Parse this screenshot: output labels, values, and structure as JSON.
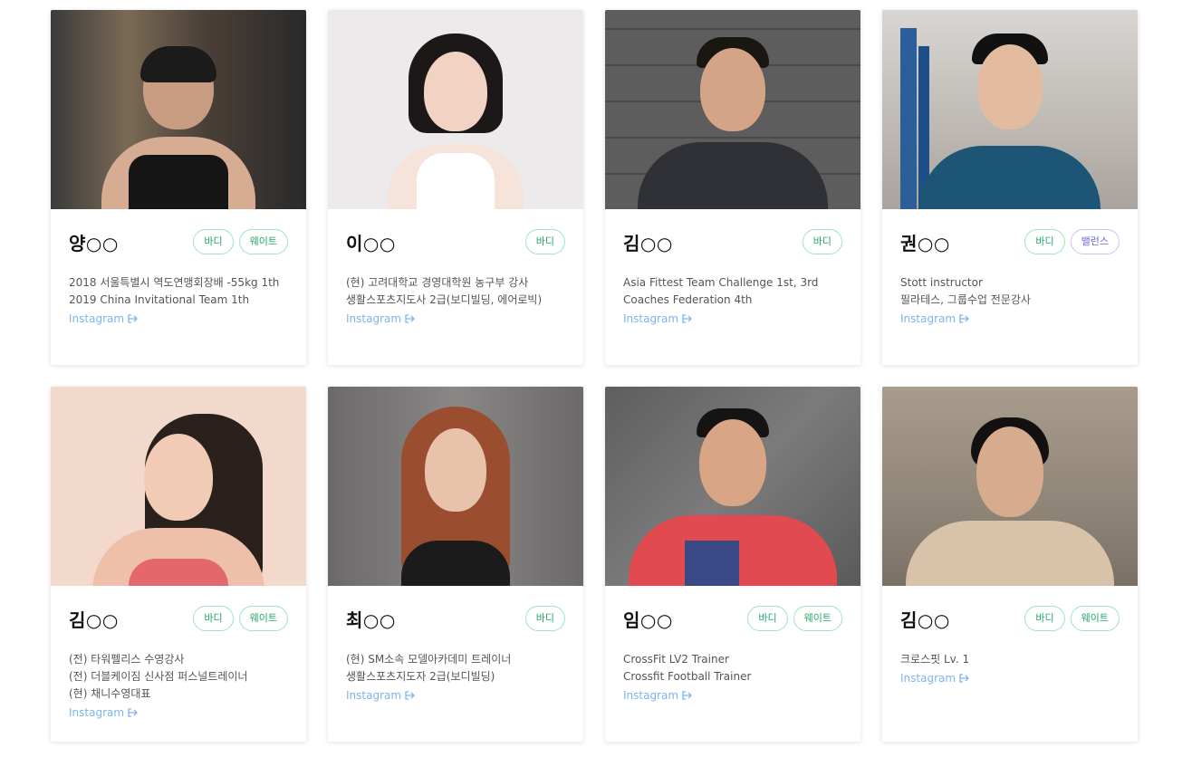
{
  "instagram_label": "Instagram",
  "trainers": [
    {
      "name": "양○○",
      "tags": [
        "바디",
        "웨이트"
      ],
      "desc": [
        "2018 서울특별시 역도연맹회장배 -55kg 1th",
        "2019 China Invitational Team 1th"
      ]
    },
    {
      "name": "이○○",
      "tags": [
        "바디"
      ],
      "desc": [
        "(현) 고려대학교 경영대학원 농구부 강사",
        "생활스포츠지도사 2급(보디빌딩, 에어로빅)"
      ]
    },
    {
      "name": "김○○",
      "tags": [
        "바디"
      ],
      "desc": [
        "Asia Fittest Team Challenge 1st, 3rd",
        "Coaches Federation 4th"
      ]
    },
    {
      "name": "권○○",
      "tags": [
        "바디",
        "밸런스"
      ],
      "desc": [
        "Stott instructor",
        "필라테스, 그룹수업 전문강사"
      ]
    },
    {
      "name": "김○○",
      "tags": [
        "바디",
        "웨이트"
      ],
      "desc": [
        "(전) 타워펠리스 수영강사",
        "(전) 더블케이짐 신사점 퍼스널트레이너",
        "(현) 채니수영대표"
      ]
    },
    {
      "name": "최○○",
      "tags": [
        "바디"
      ],
      "desc": [
        "(현) SM소속 모델아카데미 트레이너",
        "생활스포츠지도자 2급(보디빌딩)"
      ]
    },
    {
      "name": "임○○",
      "tags": [
        "바디",
        "웨이트"
      ],
      "desc": [
        "CrossFit LV2 Trainer",
        "Crossfit Football Trainer"
      ]
    },
    {
      "name": "김○○",
      "tags": [
        "바디",
        "웨이트"
      ],
      "desc": [
        "크로스핏 Lv. 1"
      ]
    }
  ]
}
